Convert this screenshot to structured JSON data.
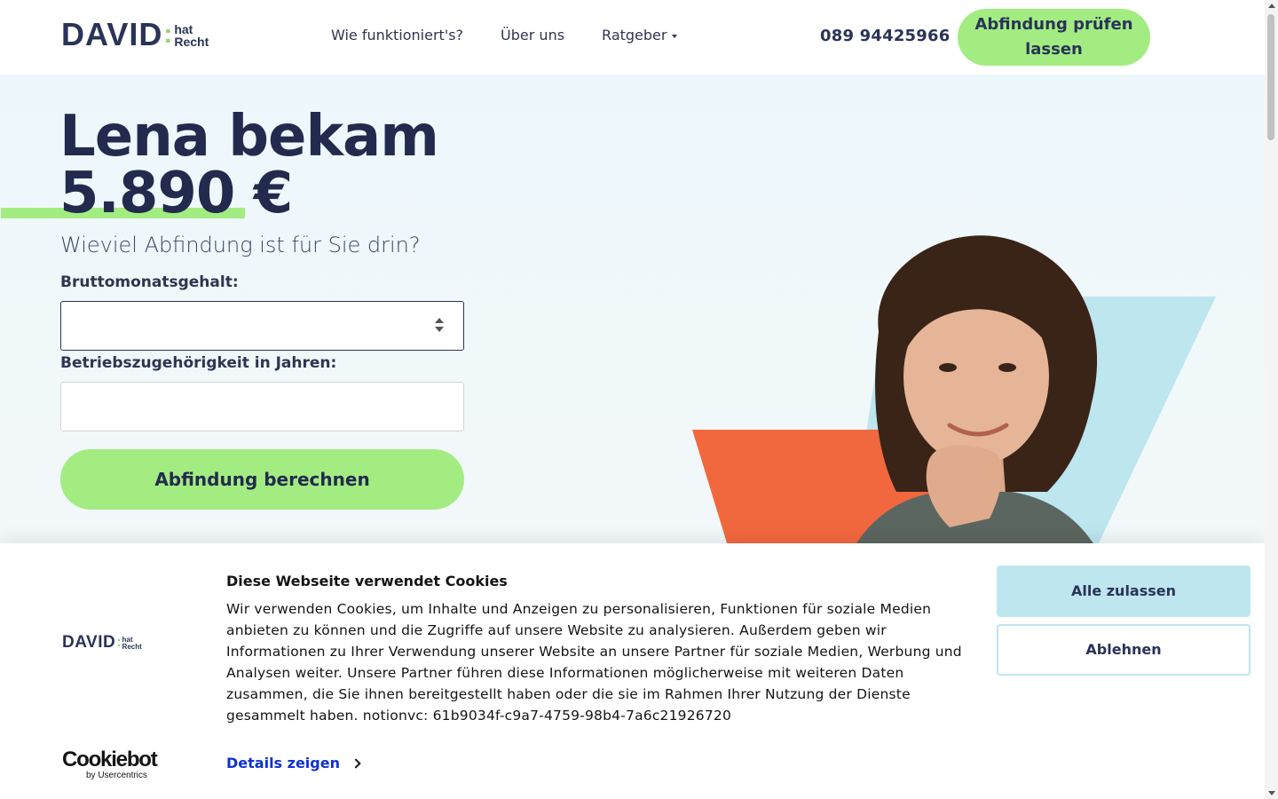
{
  "header": {
    "logo": {
      "main": "DAVID",
      "colon": ":",
      "line1": "hat",
      "line2": "Recht"
    },
    "nav": [
      {
        "label": "Wie funktioniert's?"
      },
      {
        "label": "Über uns"
      },
      {
        "label": "Ratgeber"
      }
    ],
    "phone": "089 94425966",
    "cta_label": "Abfindung prüfen lassen"
  },
  "hero": {
    "headline_line1": "Lena bekam",
    "headline_amount": "5.890 €",
    "subhead": "Wieviel Abfindung ist für Sie drin?",
    "salary_label": "Bruttomonatsgehalt:",
    "salary_value": "",
    "years_label": "Betriebszugehörigkeit in Jahren:",
    "years_value": "",
    "calc_button": "Abfindung berechnen"
  },
  "cookie": {
    "title": "Diese Webseite verwendet Cookies",
    "text": "Wir verwenden Cookies, um Inhalte und Anzeigen zu personalisieren, Funktionen für soziale Medien anbieten zu können und die Zugriffe auf unsere Website zu analysieren. Außerdem geben wir Informationen zu Ihrer Verwendung unserer Website an unsere Partner für soziale Medien, Werbung und Analysen weiter. Unsere Partner führen diese Informationen möglicherweise mit weiteren Daten zusammen, die Sie ihnen bereitgestellt haben oder die sie im Rahmen Ihrer Nutzung der Dienste gesammelt haben. notionvc: 61b9034f-c9a7-4759-98b4-7a6c21926720",
    "details_label": "Details zeigen",
    "allow_label": "Alle zulassen",
    "deny_label": "Ablehnen",
    "cookiebot_main": "Cookiebot",
    "cookiebot_sub": "by Usercentrics"
  },
  "colors": {
    "brand_navy": "#222b4e",
    "accent_green": "#a3ec82",
    "hero_bg": "#edf7fb",
    "shape_blue": "#bde6ef",
    "shape_orange": "#f2683e",
    "link_blue": "#1032cf"
  },
  "icons": {
    "nav_dropdown": "caret-down-icon",
    "number_spinner": "spinner-arrows-icon",
    "details_chevron": "chevron-right-icon"
  }
}
